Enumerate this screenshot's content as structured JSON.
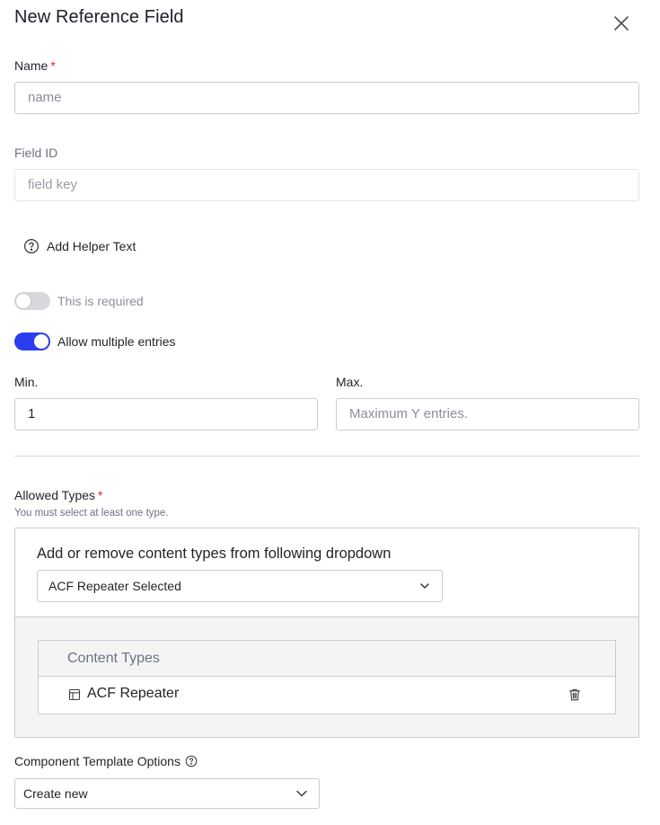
{
  "dialog": {
    "title": "New Reference Field"
  },
  "name_field": {
    "label": "Name",
    "required_mark": "*",
    "placeholder": "name"
  },
  "field_id": {
    "label": "Field ID",
    "placeholder": "field key"
  },
  "helper_text": {
    "label": "Add Helper Text",
    "icon": "question-circle-icon"
  },
  "required_toggle": {
    "label": "This is required",
    "state": "off"
  },
  "multiple_toggle": {
    "label": "Allow multiple entries",
    "state": "on"
  },
  "min_field": {
    "label": "Min.",
    "value": "1"
  },
  "max_field": {
    "label": "Max.",
    "placeholder": "Maximum Y entries."
  },
  "allowed_types": {
    "label": "Allowed Types",
    "required_mark": "*",
    "hint": "You must select at least one type.",
    "dropdown_caption": "Add or remove content types from following dropdown",
    "dropdown_value": "ACF Repeater Selected",
    "table_header": "Content Types",
    "rows": [
      {
        "label": "ACF Repeater",
        "icon": "layout-icon"
      }
    ]
  },
  "component_template": {
    "label": "Component Template Options",
    "icon": "info-circle-icon",
    "value": "Create new"
  },
  "colors": {
    "accent": "#2b3df0",
    "required": "#dc2626"
  }
}
